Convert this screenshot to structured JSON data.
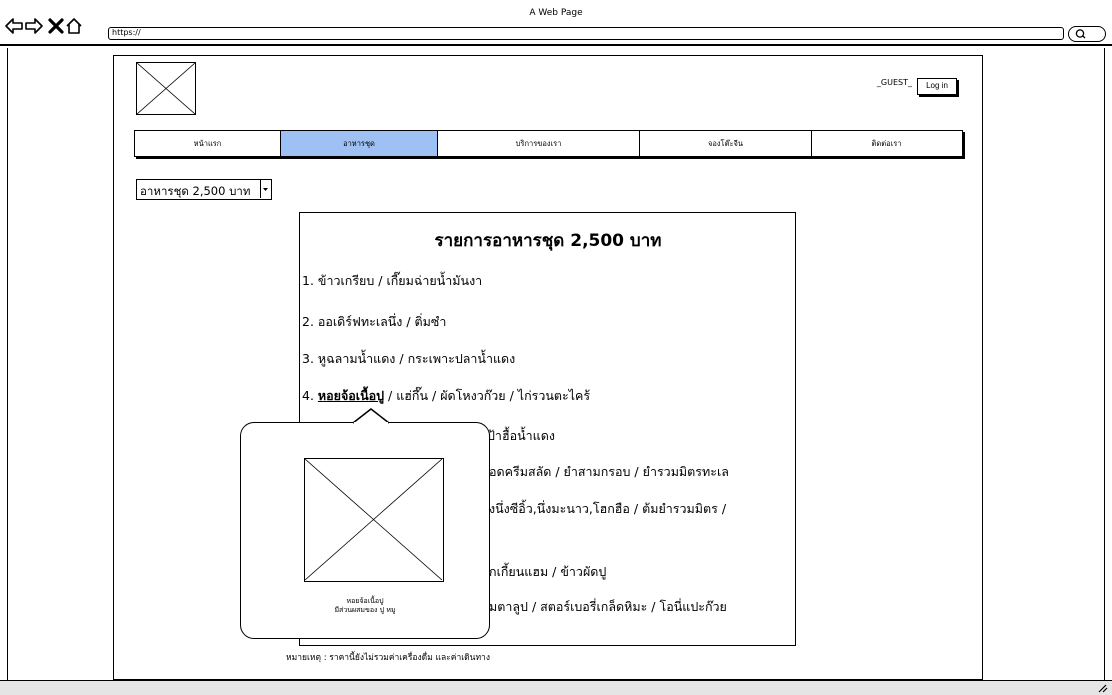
{
  "window": {
    "title": "A Web Page"
  },
  "address_bar": {
    "url": "https://"
  },
  "header": {
    "guest_text": "_GUEST_",
    "login_label": "Log in"
  },
  "nav": {
    "tabs": [
      {
        "label": "หน้าแรก",
        "active": false
      },
      {
        "label": "อาหารชุด",
        "active": true
      },
      {
        "label": "บริการของเรา",
        "active": false
      },
      {
        "label": "จองโต๊ะจีน",
        "active": false
      },
      {
        "label": "ติดต่อเรา",
        "active": false
      }
    ]
  },
  "dropdown": {
    "value": "อาหารชุด 2,500 บาท"
  },
  "menu": {
    "title": "รายการอาหารชุด 2,500 บาท",
    "items": [
      {
        "text": "1. ข้าวเกรียบ / เกี๊ยมฉ่ายน้ำมันงา"
      },
      {
        "text": "2. ออเดิร์ฟทะเลนึ่ง / ติ่มซำ"
      },
      {
        "text": "3. หูฉลามน้ำแดง / กระเพาะปลาน้ำแดง"
      },
      {
        "prefix": "4. ",
        "highlight": "หอยจ้อเนื้อปู",
        "rest": " / แฮ่กึ๊น / ผัดโหงวก๊วย / ไก่รวนตะไคร้"
      },
      {
        "text": "ป้าฮื้อน้ำแดง"
      },
      {
        "text": "อดครีมสลัด / ยำสามกรอบ / ยำรวมมิตรทะเล"
      },
      {
        "text": "งนึ่งซีอิ้ว,นึ่งมะนาว,โฮกฮือ / ต้มยำรวมมิตร /"
      },
      {
        "text": "กเกี้ยนแฮม / ข้าวผัดปู"
      },
      {
        "text": "มตาลูป / สตอร์เบอรี่เกล็ดหิมะ / โอนี่แปะก๊วย"
      }
    ],
    "note": "หมายเหตุ : ราคานี้ยังไม่รวมค่าเครื่องดื่ม และค่าเดินทาง"
  },
  "tooltip": {
    "caption_line1": "หอยจ้อเนื้อปู",
    "caption_line2": "มีส่วนผสมของ ปู หมู"
  },
  "colors": {
    "active_tab": "#9ec0f2",
    "bottom_bar": "#e5e5e5"
  },
  "icons": [
    "back-arrow-icon",
    "forward-arrow-icon",
    "close-x-icon",
    "home-icon",
    "search-icon",
    "chevron-down-icon",
    "resize-grip-icon"
  ]
}
